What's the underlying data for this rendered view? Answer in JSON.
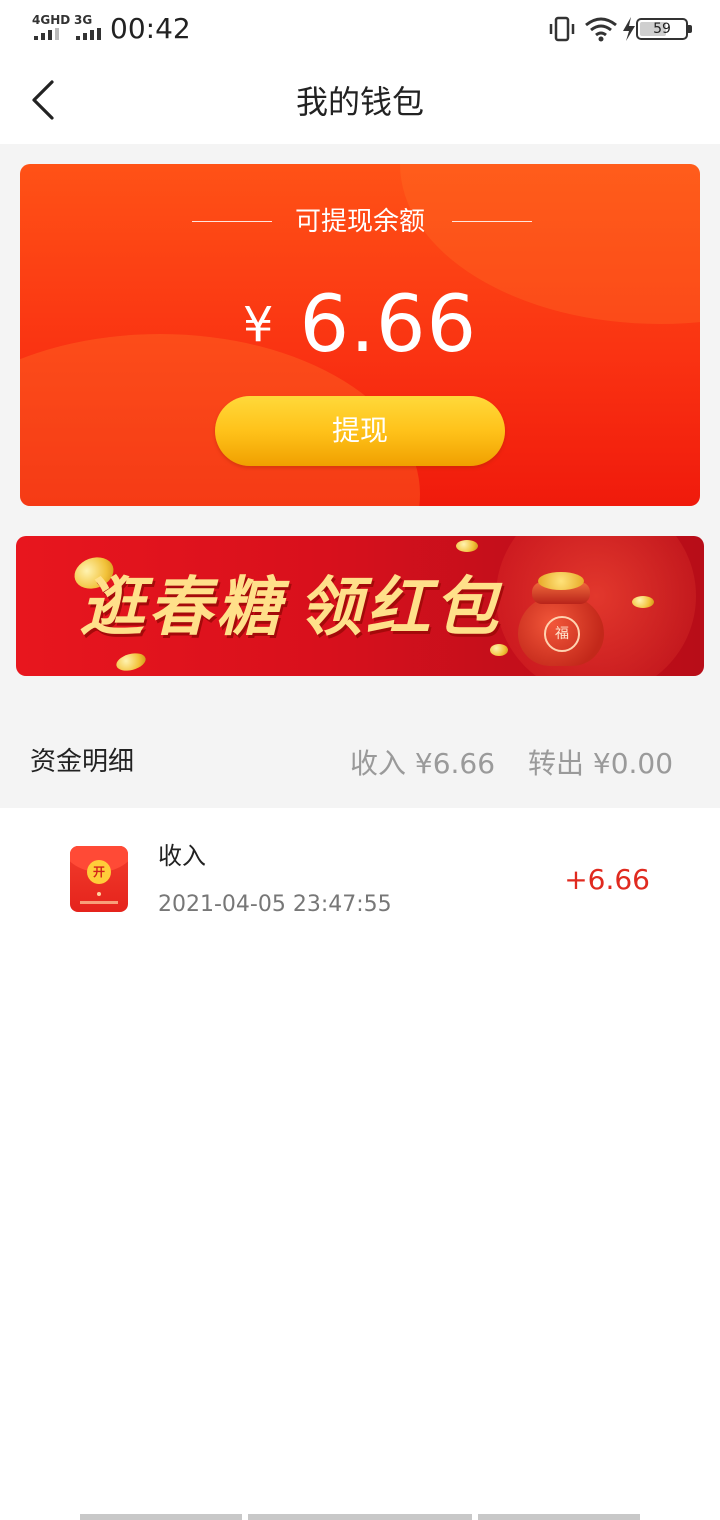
{
  "status_bar": {
    "signal1_label": "4GHD",
    "signal2_label": "3G",
    "time": "00:42",
    "battery": "59"
  },
  "header": {
    "title": "我的钱包",
    "back_icon": "chevron-left-icon"
  },
  "balance": {
    "label": "可提现余额",
    "currency": "¥",
    "amount": "6.66",
    "withdraw_label": "提现"
  },
  "banner": {
    "text_part1": "逛春糖",
    "text_part2": "领红包",
    "seal": "福"
  },
  "funds": {
    "title": "资金明细",
    "income_summary": "收入 ¥6.66",
    "outgoing_summary": "转出 ¥0.00"
  },
  "transactions": [
    {
      "type": "收入",
      "time": "2021-04-05 23:47:55",
      "amount": "+6.66",
      "icon": "red-envelope-icon",
      "icon_label": "开"
    }
  ],
  "colors": {
    "card_red": "#fa3312",
    "button_gold": "#ffc21a",
    "amount_red": "#e02a1f",
    "grey_bg": "#f4f4f4"
  }
}
